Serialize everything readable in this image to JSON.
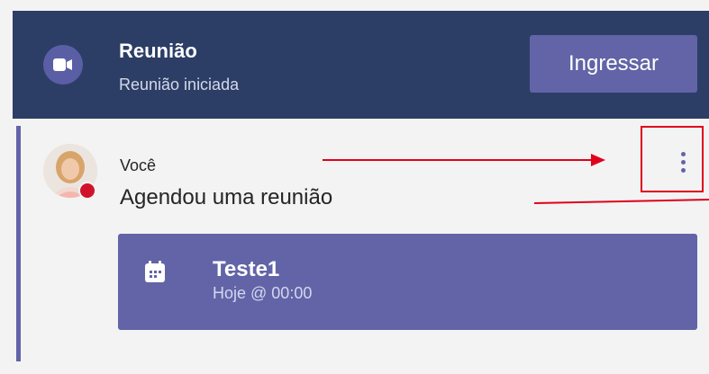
{
  "meeting_banner": {
    "title": "Reunião",
    "subtitle": "Reunião iniciada",
    "join_label": "Ingressar",
    "icon": "video-camera-icon"
  },
  "message": {
    "sender": "Você",
    "text": "Agendou uma reunião",
    "avatar_status": "busy",
    "more_icon": "more-options-icon"
  },
  "meeting_card": {
    "title": "Teste1",
    "subtitle": "Hoje @ 00:00",
    "icon": "calendar-icon"
  },
  "colors": {
    "banner_bg": "#2c3e66",
    "accent": "#6264a7",
    "status_red": "#d0132b",
    "annotation_red": "#e0001b"
  }
}
